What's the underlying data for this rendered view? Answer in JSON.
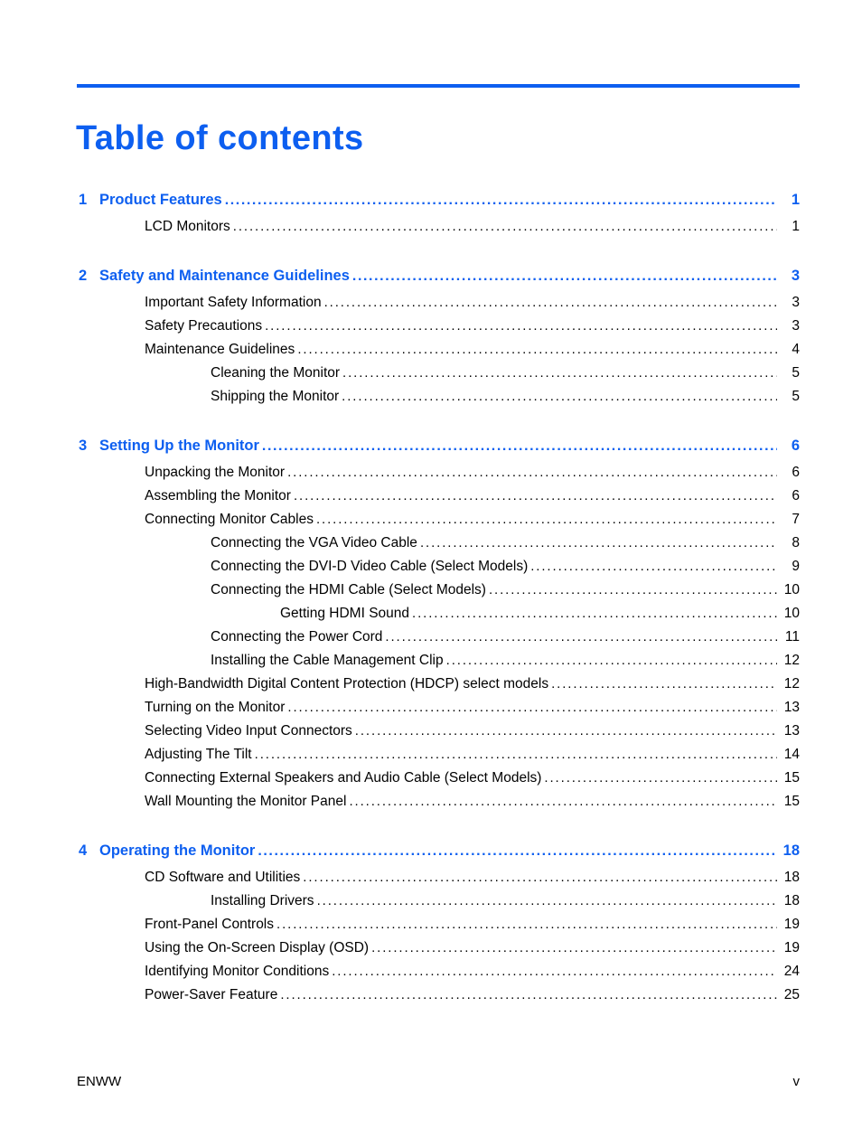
{
  "document": {
    "title": "Table of contents",
    "accent_color": "#0d5ff0",
    "text_color": "#000000"
  },
  "toc": {
    "leader_char": "................................................................................................................................................................................",
    "entries": [
      {
        "level": 0,
        "number": "1",
        "label": "Product Features",
        "page": "1",
        "gap_before": false
      },
      {
        "level": 1,
        "number": "",
        "label": "LCD Monitors",
        "page": "1",
        "gap_before": false
      },
      {
        "level": 0,
        "number": "2",
        "label": "Safety and Maintenance Guidelines",
        "page": "3",
        "gap_before": true
      },
      {
        "level": 1,
        "number": "",
        "label": "Important Safety Information",
        "page": "3",
        "gap_before": false
      },
      {
        "level": 1,
        "number": "",
        "label": "Safety Precautions",
        "page": "3",
        "gap_before": false
      },
      {
        "level": 1,
        "number": "",
        "label": "Maintenance Guidelines",
        "page": "4",
        "gap_before": false
      },
      {
        "level": 2,
        "number": "",
        "label": "Cleaning the Monitor",
        "page": "5",
        "gap_before": false
      },
      {
        "level": 2,
        "number": "",
        "label": "Shipping the Monitor",
        "page": "5",
        "gap_before": false
      },
      {
        "level": 0,
        "number": "3",
        "label": "Setting Up the Monitor",
        "page": "6",
        "gap_before": true
      },
      {
        "level": 1,
        "number": "",
        "label": "Unpacking the Monitor",
        "page": "6",
        "gap_before": false
      },
      {
        "level": 1,
        "number": "",
        "label": "Assembling the Monitor",
        "page": "6",
        "gap_before": false
      },
      {
        "level": 1,
        "number": "",
        "label": "Connecting Monitor Cables",
        "page": "7",
        "gap_before": false
      },
      {
        "level": 2,
        "number": "",
        "label": "Connecting the VGA Video Cable",
        "page": "8",
        "gap_before": false
      },
      {
        "level": 2,
        "number": "",
        "label": "Connecting the DVI-D Video Cable (Select Models)",
        "page": "9",
        "gap_before": false
      },
      {
        "level": 2,
        "number": "",
        "label": "Connecting the HDMI Cable (Select Models)",
        "page": "10",
        "gap_before": false
      },
      {
        "level": 3,
        "number": "",
        "label": "Getting HDMI Sound",
        "page": "10",
        "gap_before": false
      },
      {
        "level": 2,
        "number": "",
        "label": "Connecting the Power Cord",
        "page": "11",
        "gap_before": false
      },
      {
        "level": 2,
        "number": "",
        "label": "Installing the Cable Management Clip",
        "page": "12",
        "gap_before": false
      },
      {
        "level": 1,
        "number": "",
        "label": "High-Bandwidth Digital Content Protection (HDCP) select models",
        "page": "12",
        "gap_before": false
      },
      {
        "level": 1,
        "number": "",
        "label": "Turning on the Monitor",
        "page": "13",
        "gap_before": false
      },
      {
        "level": 1,
        "number": "",
        "label": "Selecting Video Input Connectors",
        "page": "13",
        "gap_before": false
      },
      {
        "level": 1,
        "number": "",
        "label": "Adjusting The Tilt",
        "page": "14",
        "gap_before": false
      },
      {
        "level": 1,
        "number": "",
        "label": "Connecting External Speakers and Audio Cable (Select Models)",
        "page": "15",
        "gap_before": false
      },
      {
        "level": 1,
        "number": "",
        "label": "Wall Mounting the Monitor Panel",
        "page": "15",
        "gap_before": false
      },
      {
        "level": 0,
        "number": "4",
        "label": "Operating the Monitor",
        "page": "18",
        "gap_before": true
      },
      {
        "level": 1,
        "number": "",
        "label": "CD Software and Utilities",
        "page": "18",
        "gap_before": false
      },
      {
        "level": 2,
        "number": "",
        "label": "Installing Drivers",
        "page": "18",
        "gap_before": false
      },
      {
        "level": 1,
        "number": "",
        "label": "Front-Panel Controls",
        "page": "19",
        "gap_before": false
      },
      {
        "level": 1,
        "number": "",
        "label": "Using the On-Screen Display (OSD)",
        "page": "19",
        "gap_before": false
      },
      {
        "level": 1,
        "number": "",
        "label": "Identifying Monitor Conditions",
        "page": "24",
        "gap_before": false
      },
      {
        "level": 1,
        "number": "",
        "label": "Power-Saver Feature",
        "page": "25",
        "gap_before": false
      }
    ]
  },
  "footer": {
    "left": "ENWW",
    "right": "v"
  }
}
